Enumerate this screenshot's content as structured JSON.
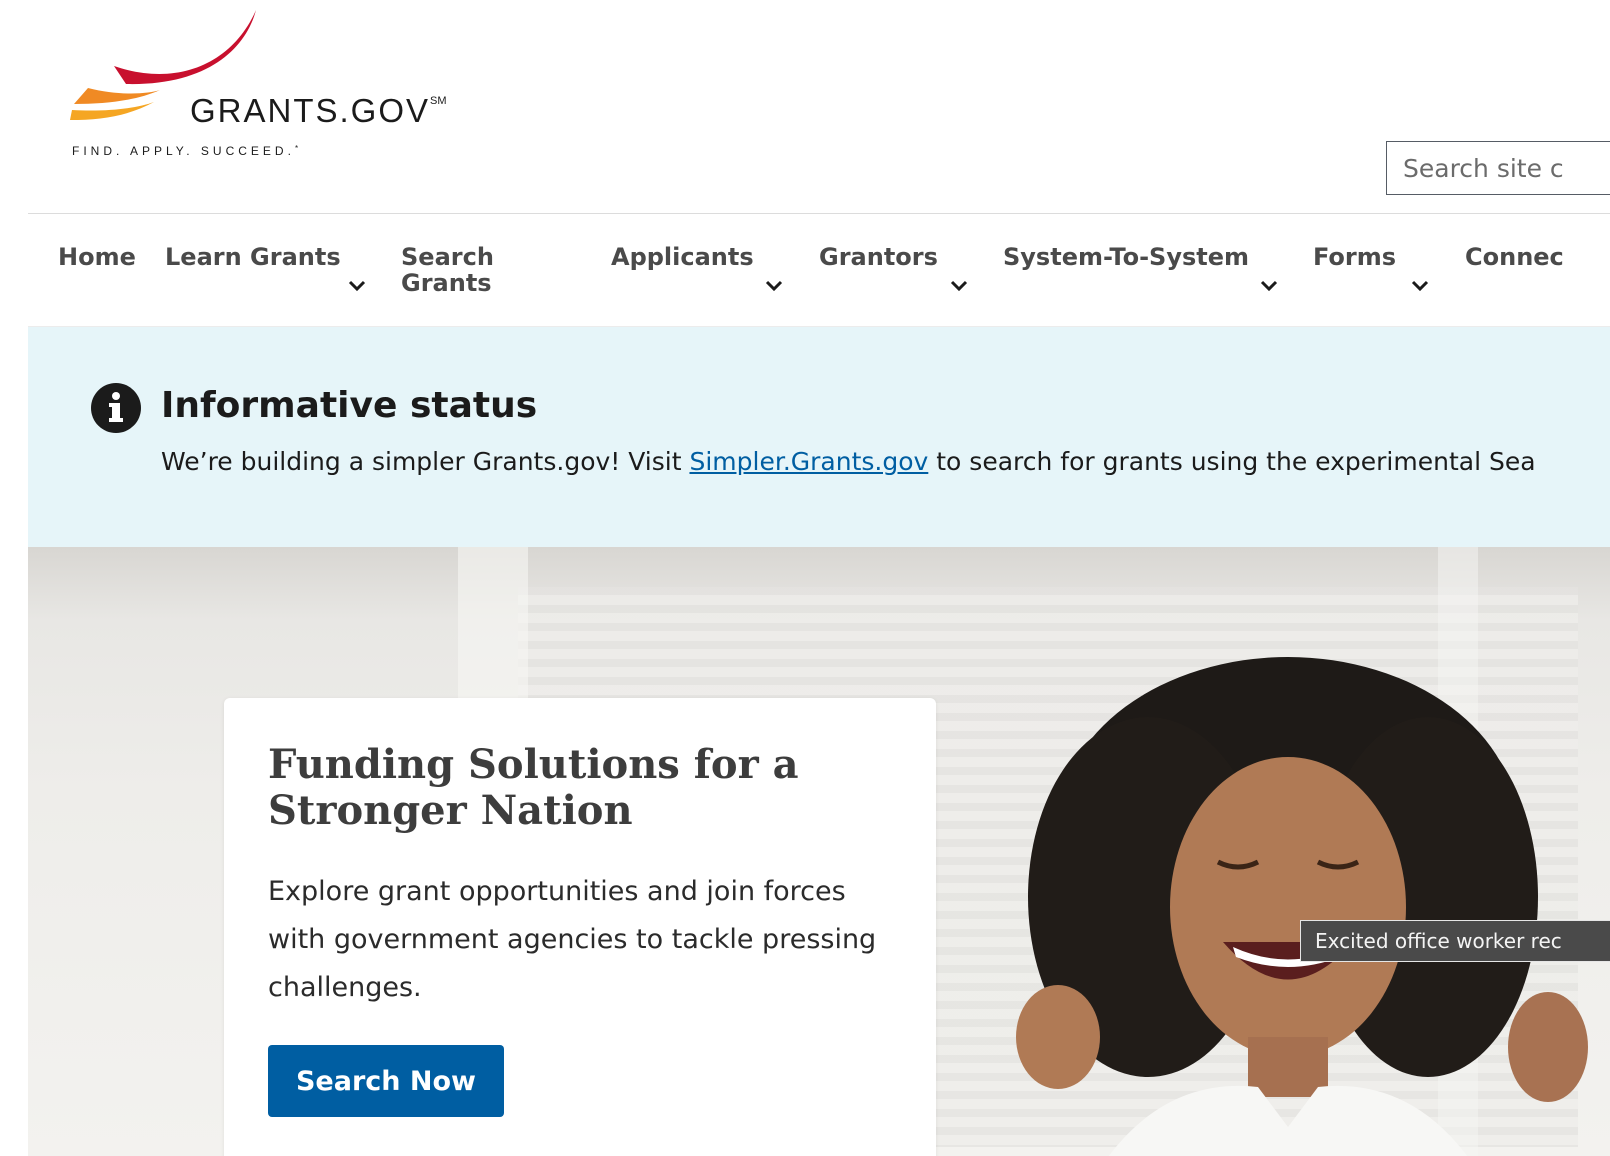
{
  "colors": {
    "primary_blue": "#005ea2",
    "alert_background": "#e6f5f9",
    "logo_red": "#c8102e",
    "logo_orange": "#f08a24",
    "nav_text": "#4a4a4a"
  },
  "header": {
    "logo": {
      "wordmark": "GRANTS.GOV",
      "service_mark": "SM",
      "tagline": "FIND. APPLY. SUCCEED.",
      "tagline_mark": "*"
    },
    "search": {
      "placeholder": "Search site c",
      "value": ""
    }
  },
  "nav": {
    "items": [
      {
        "label": "Home",
        "has_dropdown": false
      },
      {
        "label": "Learn Grants",
        "has_dropdown": true
      },
      {
        "label_line1": "Search",
        "label_line2": "Grants",
        "has_dropdown": false
      },
      {
        "label": "Applicants",
        "has_dropdown": true
      },
      {
        "label": "Grantors",
        "has_dropdown": true
      },
      {
        "label": "System-To-System",
        "has_dropdown": true
      },
      {
        "label": "Forms",
        "has_dropdown": true
      },
      {
        "label": "Connec",
        "has_dropdown": false
      }
    ]
  },
  "alert": {
    "icon": "info-icon",
    "title": "Informative status",
    "body_before_link": "We’re building a simpler Grants.gov! Visit ",
    "link_text": "Simpler.Grants.gov",
    "body_after_link": " to search for grants using the experimental Sea"
  },
  "hero": {
    "title": "Funding Solutions for a Stronger Nation",
    "text": "Explore grant opportunities and join forces with government agencies to tackle pressing challenges.",
    "button_label": "Search Now",
    "image_tooltip": "Excited office worker rec"
  }
}
